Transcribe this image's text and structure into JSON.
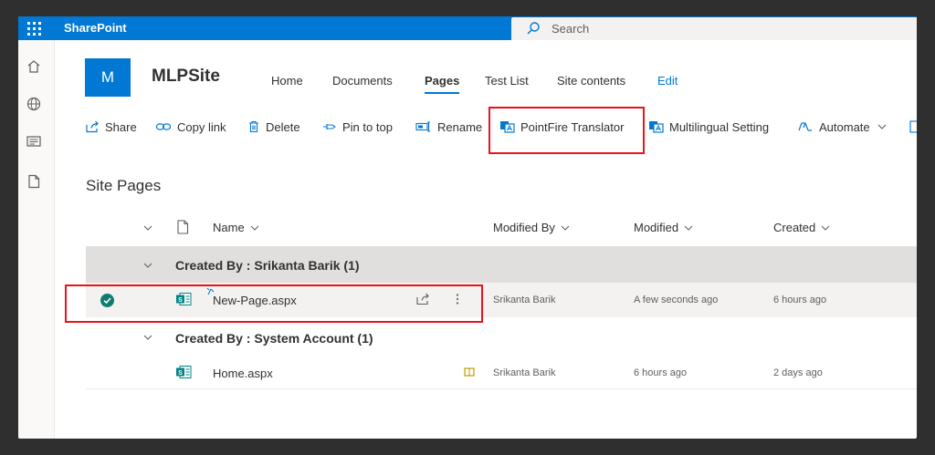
{
  "app": {
    "brand": "SharePoint",
    "search_placeholder": "Search"
  },
  "site": {
    "logo_letter": "M",
    "title": "MLPSite",
    "nav": [
      "Home",
      "Documents",
      "Pages",
      "Test List",
      "Site contents",
      "Edit"
    ],
    "active_nav": "Pages"
  },
  "commandbar": {
    "share": "Share",
    "copy_link": "Copy link",
    "delete": "Delete",
    "pin_to_top": "Pin to top",
    "rename": "Rename",
    "pointfire": "PointFire Translator",
    "multilingual": "Multilingual Setting",
    "automate": "Automate"
  },
  "list": {
    "heading": "Site Pages",
    "columns": {
      "name": "Name",
      "modified_by": "Modified By",
      "modified": "Modified",
      "created": "Created"
    },
    "groups": [
      {
        "label": "Created By : Srikanta Barik (1)",
        "rows": [
          {
            "name": "New-Page.aspx",
            "modified_by": "Srikanta Barik",
            "modified": "A few seconds ago",
            "created": "6 hours ago",
            "selected": true
          }
        ]
      },
      {
        "label": "Created By : System Account (1)",
        "rows": [
          {
            "name": "Home.aspx",
            "modified_by": "Srikanta Barik",
            "modified": "6 hours ago",
            "created": "2 days ago",
            "selected": false
          }
        ]
      }
    ]
  },
  "colors": {
    "accent": "#0078d4",
    "highlight": "#e8141c",
    "selected_check": "#107c6f"
  }
}
